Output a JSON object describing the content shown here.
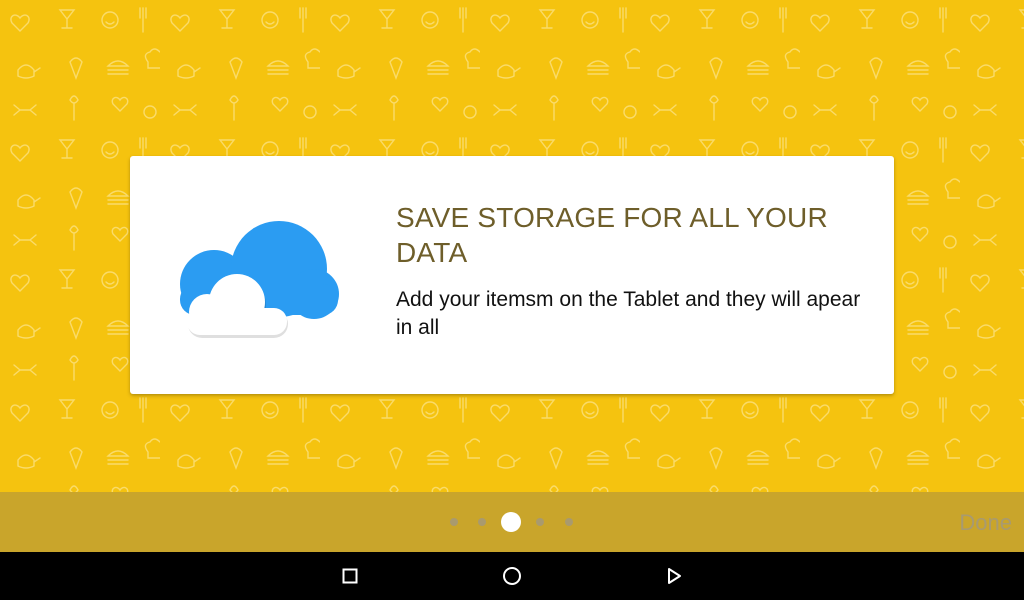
{
  "slide": {
    "title": "SAVE STORAGE FOR ALL YOUR DATA",
    "body": "Add your itemsm on the Tablet and they will apear in all",
    "illustration": "cloud-icon"
  },
  "pager": {
    "count": 5,
    "active_index": 2
  },
  "bottom_bar": {
    "done_label": "Done"
  },
  "nav": {
    "recents": "square-icon",
    "home": "circle-icon",
    "back": "triangle-icon"
  },
  "colors": {
    "background": "#F5C30F",
    "bottom_bar": "#C9A52B",
    "title": "#6E5E2A",
    "cloud_back": "#2B9CF2",
    "cloud_front": "#FFFFFF"
  }
}
